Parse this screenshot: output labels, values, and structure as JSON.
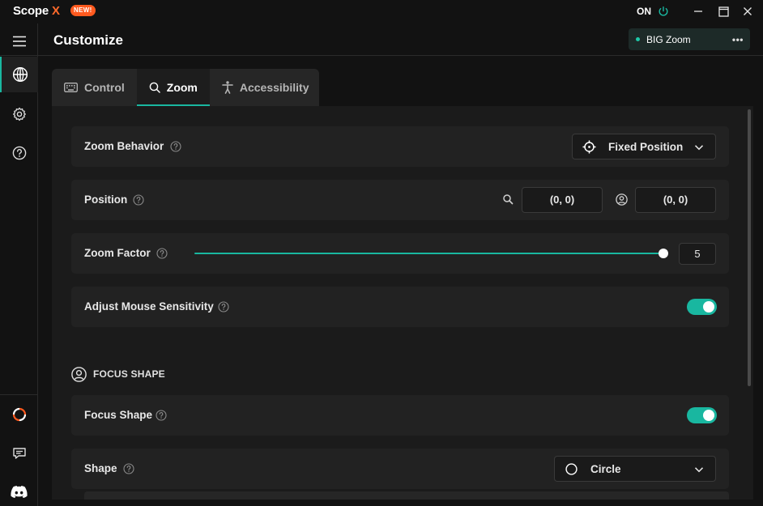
{
  "app": {
    "name": "Scope",
    "name_suffix": "X",
    "badge": "NEW!",
    "power_label": "ON"
  },
  "header": {
    "title": "Customize",
    "profile": {
      "name": "BIG Zoom",
      "more": "•••"
    }
  },
  "tabs": [
    {
      "label": "Control",
      "icon": "keyboard-icon",
      "active": false
    },
    {
      "label": "Zoom",
      "icon": "search-icon",
      "active": true
    },
    {
      "label": "Accessibility",
      "icon": "accessibility-icon",
      "active": false
    }
  ],
  "settings": {
    "zoom_behavior": {
      "label": "Zoom Behavior",
      "value": "Fixed Position"
    },
    "position": {
      "label": "Position",
      "zoom_coord": "(0, 0)",
      "user_coord": "(0, 0)"
    },
    "zoom_factor": {
      "label": "Zoom Factor",
      "value": "5",
      "level": 1.0
    },
    "mouse_sensitivity": {
      "label": "Adjust Mouse Sensitivity",
      "enabled": true
    }
  },
  "focus_section": {
    "heading": "FOCUS SHAPE",
    "focus_shape": {
      "label": "Focus Shape",
      "enabled": true
    },
    "shape": {
      "label": "Shape",
      "value": "Circle"
    }
  },
  "colors": {
    "accent": "#19b7a0",
    "badge": "#ff5a1f",
    "brand_x": "#ff6a2b",
    "background": "#121212",
    "panel": "#1b1b1b",
    "row": "#222222"
  }
}
